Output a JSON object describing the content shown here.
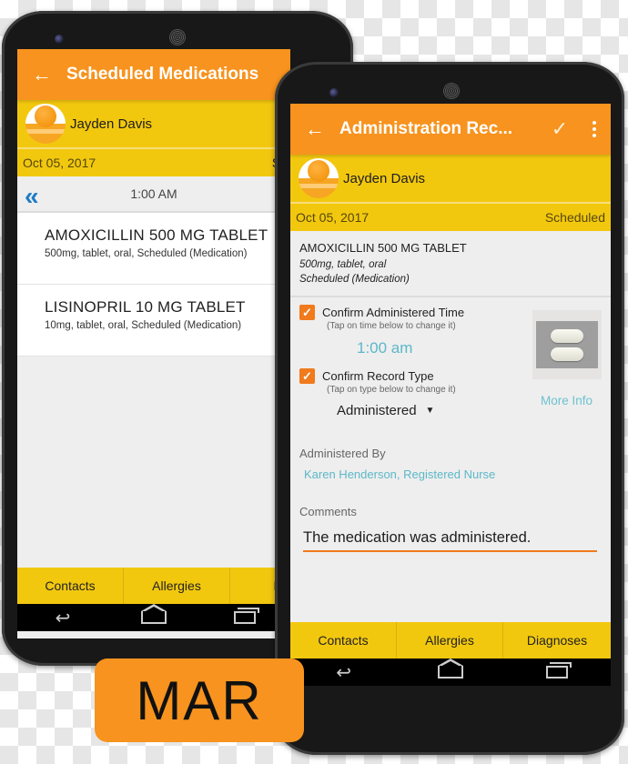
{
  "colors": {
    "appbar": "#f7931e",
    "patient_bar": "#f2c80f",
    "accent_teal": "#5cb8c8",
    "checkbox": "#f07a1c",
    "nav_blue": "#1f7bc4"
  },
  "left_phone": {
    "appbar": {
      "back_icon": "arrow-left",
      "title": "Scheduled Medications"
    },
    "patient": {
      "name": "Jayden Davis"
    },
    "datebar": {
      "date": "Oct 05, 2017",
      "status": "Sche"
    },
    "timebar": {
      "prev_icon": "double-chevron-left",
      "prev_glyph": "«",
      "time": "1:00 AM"
    },
    "medications": [
      {
        "name": "AMOXICILLIN 500 MG TABLET",
        "description": "500mg, tablet, oral, Scheduled (Medication)"
      },
      {
        "name": "LISINOPRIL 10 MG TABLET",
        "description": "10mg, tablet, oral, Scheduled (Medication)"
      }
    ],
    "bottom_tabs": [
      "Contacts",
      "Allergies",
      "Dia"
    ],
    "navbar": {
      "back_glyph": "↩"
    }
  },
  "right_phone": {
    "appbar": {
      "back_icon": "arrow-left",
      "title": "Administration Rec...",
      "check_glyph": "✓",
      "more_icon": "overflow-menu"
    },
    "patient": {
      "name": "Jayden Davis"
    },
    "datebar": {
      "date": "Oct 05, 2017",
      "status": "Scheduled"
    },
    "medication": {
      "name": "AMOXICILLIN 500 MG TABLET",
      "dose": "500mg, tablet, oral",
      "type": "Scheduled (Medication)"
    },
    "confirm_time": {
      "checked": true,
      "label": "Confirm Administered Time",
      "hint": "(Tap on time below to change it)",
      "value": "1:00 am"
    },
    "confirm_type": {
      "checked": true,
      "label": "Confirm Record Type",
      "hint": "(Tap on type below to change it)",
      "value": "Administered",
      "caret_glyph": "▼"
    },
    "more_info": "More Info",
    "administered_by": {
      "label": "Administered By",
      "value": "Karen Henderson, Registered Nurse"
    },
    "comments": {
      "label": "Comments",
      "value": "The medication was administered."
    },
    "bottom_tabs": [
      "Contacts",
      "Allergies",
      "Diagnoses"
    ],
    "navbar": {
      "back_glyph": "↩"
    }
  },
  "badge": {
    "label": "MAR"
  },
  "checkmark_glyph": "✓",
  "back_arrow_glyph": "←"
}
